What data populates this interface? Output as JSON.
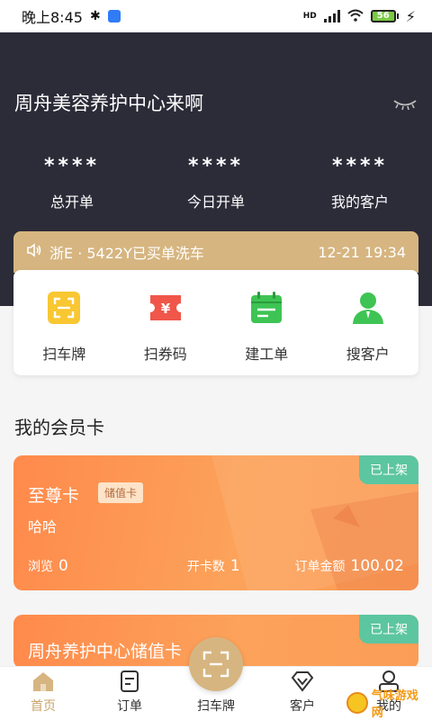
{
  "status_bar": {
    "time": "晚上8:45",
    "network": "HD",
    "battery": "56"
  },
  "hero": {
    "store_name": "周舟美容养护中心来啊",
    "stats": [
      {
        "value": "****",
        "label": "总开单"
      },
      {
        "value": "****",
        "label": "今日开单"
      },
      {
        "value": "****",
        "label": "我的客户"
      }
    ]
  },
  "notice": {
    "message": "浙E · 5422Y已买单洗车",
    "time": "12-21 19:34"
  },
  "actions": [
    {
      "label": "扫车牌",
      "icon": "scan-plate-icon"
    },
    {
      "label": "扫券码",
      "icon": "ticket-icon"
    },
    {
      "label": "建工单",
      "icon": "work-order-icon"
    },
    {
      "label": "搜客户",
      "icon": "customer-icon"
    }
  ],
  "section_title": "我的会员卡",
  "cards": [
    {
      "tag": "已上架",
      "name": "至尊卡",
      "type": "储值卡",
      "desc": "哈哈",
      "views_label": "浏览",
      "views": "0",
      "opened_label": "开卡数",
      "opened": "1",
      "amount_label": "订单金额",
      "amount": "100.02"
    },
    {
      "tag": "已上架",
      "name": "周舟养护中心储值卡"
    }
  ],
  "tabbar": [
    {
      "label": "首页",
      "icon": "home-icon",
      "active": true
    },
    {
      "label": "订单",
      "icon": "order-icon"
    },
    {
      "label": "扫车牌",
      "icon": "scan-icon"
    },
    {
      "label": "客户",
      "icon": "diamond-icon"
    },
    {
      "label": "我的",
      "icon": "profile-icon"
    }
  ],
  "watermark": {
    "text": "气味游戏网"
  },
  "colors": {
    "hero_bg": "#2c2b38",
    "gold": "#d6b580",
    "card_orange": "#fc9a55",
    "tag_green": "#5cc6a0",
    "active_tab": "#c9a46a"
  }
}
